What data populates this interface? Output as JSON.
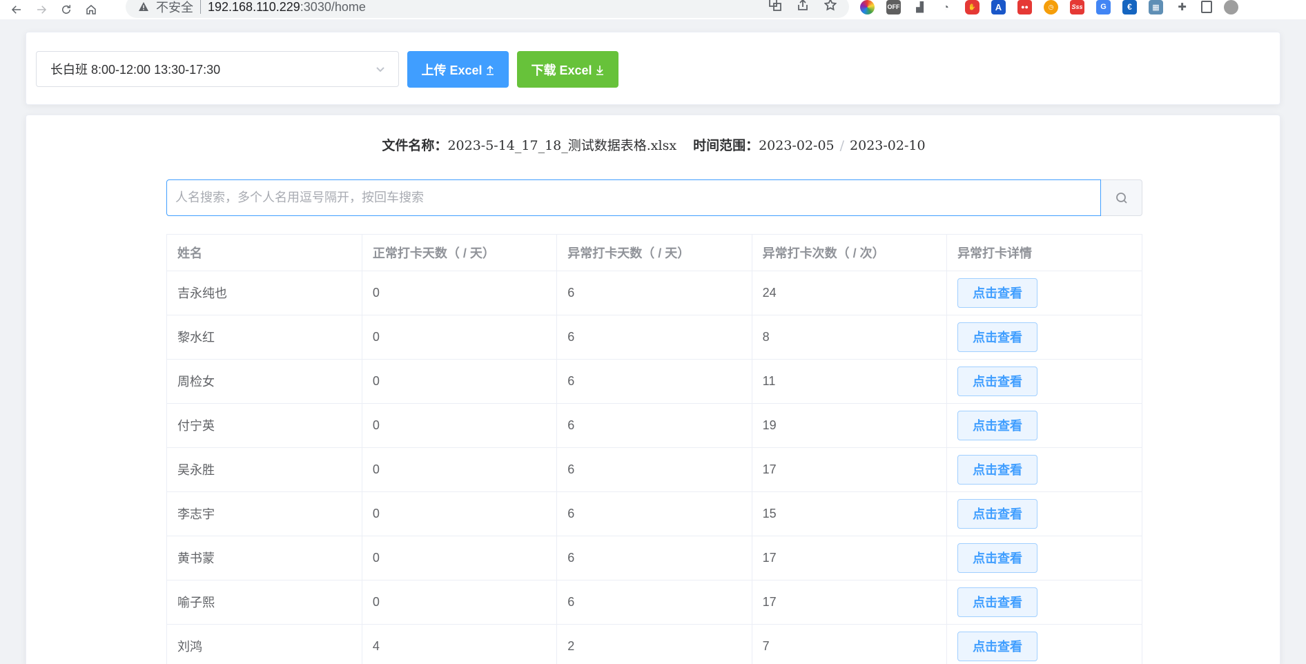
{
  "browser": {
    "insecure_label": "不安全",
    "url_host": "192.168.110.229",
    "url_path": ":3030/home"
  },
  "toolbar": {
    "shift_value": "长白班 8:00-12:00 13:30-17:30",
    "upload_label": "上传 Excel",
    "download_label": "下载 Excel"
  },
  "file_info": {
    "name_label": "文件名称：",
    "name_value": "2023-5-14_17_18_测试数据表格.xlsx",
    "range_label": "时间范围：",
    "range_start": "2023-02-05",
    "range_sep": "/",
    "range_end": "2023-02-10"
  },
  "search": {
    "placeholder": "人名搜索，多个人名用逗号隔开，按回车搜索"
  },
  "table": {
    "columns": [
      "姓名",
      "正常打卡天数（ / 天）",
      "异常打卡天数（ / 天）",
      "异常打卡次数（ / 次）",
      "异常打卡详情"
    ],
    "view_label": "点击查看",
    "rows": [
      {
        "name": "吉永纯也",
        "normal_days": "0",
        "abnormal_days": "6",
        "abnormal_count": "24"
      },
      {
        "name": "黎水红",
        "normal_days": "0",
        "abnormal_days": "6",
        "abnormal_count": "8"
      },
      {
        "name": "周检女",
        "normal_days": "0",
        "abnormal_days": "6",
        "abnormal_count": "11"
      },
      {
        "name": "付宁英",
        "normal_days": "0",
        "abnormal_days": "6",
        "abnormal_count": "19"
      },
      {
        "name": "吴永胜",
        "normal_days": "0",
        "abnormal_days": "6",
        "abnormal_count": "17"
      },
      {
        "name": "李志宇",
        "normal_days": "0",
        "abnormal_days": "6",
        "abnormal_count": "15"
      },
      {
        "name": "黄书蒙",
        "normal_days": "0",
        "abnormal_days": "6",
        "abnormal_count": "17"
      },
      {
        "name": "喻子熙",
        "normal_days": "0",
        "abnormal_days": "6",
        "abnormal_count": "17"
      },
      {
        "name": "刘鸿",
        "normal_days": "4",
        "abnormal_days": "2",
        "abnormal_count": "7"
      }
    ]
  },
  "extensions": [
    {
      "icon": "color-wheel-icon",
      "color": "#e53935"
    },
    {
      "icon": "off-icon",
      "color": "#5f5f5f"
    },
    {
      "icon": "tray-icon",
      "color": "#5f6368"
    },
    {
      "icon": "speed-icon",
      "color": "#5f6368"
    },
    {
      "icon": "adblock-icon",
      "color": "#e53935"
    },
    {
      "icon": "font-a-icon",
      "color": "#1a57c9"
    },
    {
      "icon": "readhub-icon",
      "color": "#e53935"
    },
    {
      "icon": "timer-icon",
      "color": "#f59e0b"
    },
    {
      "icon": "sss-icon",
      "color": "#e53935"
    },
    {
      "icon": "translate-icon",
      "color": "#4285f4"
    },
    {
      "icon": "euro-icon",
      "color": "#1565c0"
    },
    {
      "icon": "robot-icon",
      "color": "#5f8fb5"
    },
    {
      "icon": "puzzle-icon",
      "color": "#5f6368"
    },
    {
      "icon": "sidepanel-icon",
      "color": "#5f6368"
    },
    {
      "icon": "profile-avatar-icon",
      "color": "#9e9e9e"
    }
  ]
}
